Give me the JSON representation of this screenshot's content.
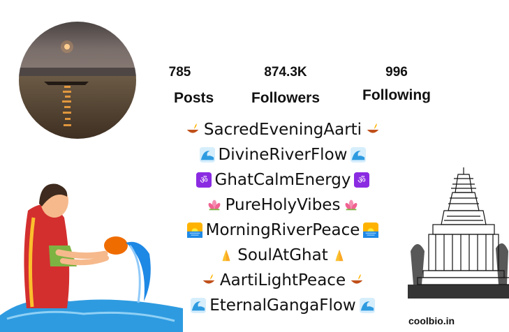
{
  "profile": {
    "stats": {
      "posts": {
        "value": "785",
        "label": "Posts"
      },
      "followers": {
        "value": "874.3K",
        "label": "Followers"
      },
      "following": {
        "value": "996",
        "label": "Following"
      }
    },
    "bio": [
      {
        "text": "SacredEveningAarti",
        "icon": "diya-icon"
      },
      {
        "text": "DivineRiverFlow",
        "icon": "wave-icon"
      },
      {
        "text": "GhatCalmEnergy",
        "icon": "om-icon"
      },
      {
        "text": "PureHolyVibes",
        "icon": "lotus-icon"
      },
      {
        "text": "MorningRiverPeace",
        "icon": "sunrise-icon"
      },
      {
        "text": "SoulAtGhat",
        "icon": "folded-hands-icon"
      },
      {
        "text": "AartiLightPeace",
        "icon": "diya-icon"
      },
      {
        "text": "EternalGangaFlow",
        "icon": "wave-icon"
      }
    ]
  },
  "brand": "coolbio.in",
  "colors": {
    "wave": "#2e9be0",
    "om": "#8a2be2",
    "lotus": "#f48fb1",
    "diya": "#e65100",
    "sunrise": "#ffb300"
  }
}
